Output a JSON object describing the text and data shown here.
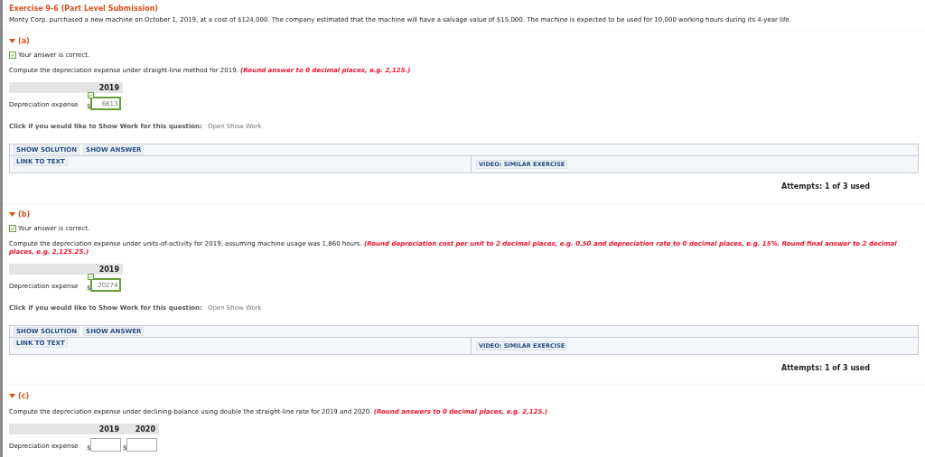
{
  "header": {
    "title": "Exercise 9-6 (Part Level Submission)",
    "description": "Monty Corp. purchased a new machine on October 1, 2019, at a cost of $124,000. The company estimated that the machine will have a salvage value of $15,000. The machine is expected to be used for 10,000 working hours during its 4-year life."
  },
  "parts": [
    {
      "label": "(a)",
      "expanded": true,
      "feedback": "Your answer is correct.",
      "question": "Compute the depreciation expense under straight-line method for 2019. **(Round answer to 0 decimal places, e.g. 2,125.)**",
      "table": {
        "columns": [
          "2019"
        ],
        "row_label": "Depreciation expense",
        "currency": "$",
        "answers": [
          {
            "value": "6813",
            "correct": true
          }
        ]
      },
      "show_work": {
        "label": "Click if you would like to Show Work for this question:",
        "link": "Open Show Work"
      },
      "buttons": [
        "SHOW SOLUTION",
        "SHOW ANSWER"
      ],
      "link_button": "LINK TO TEXT",
      "video_button": "VIDEO: SIMILAR EXERCISE",
      "attempts": "Attempts: 1 of 3 used"
    },
    {
      "label": "(b)",
      "expanded": true,
      "feedback": "Your answer is correct.",
      "question": "Compute the depreciation expense under units-of-activity for 2019, assuming machine usage was 1,860 hours. **(Round depreciation cost per unit to 2 decimal places, e.g. 0.50 and depreciation rate to 0 decimal places, e.g. 15%. Round final answer to 2 decimal places, e.g. 2,125.25.)**",
      "table": {
        "columns": [
          "2019"
        ],
        "row_label": "Depreciation expense",
        "currency": "$",
        "answers": [
          {
            "value": "20274",
            "correct": true
          }
        ]
      },
      "show_work": {
        "label": "Click if you would like to Show Work for this question:",
        "link": "Open Show Work"
      },
      "buttons": [
        "SHOW SOLUTION",
        "SHOW ANSWER"
      ],
      "link_button": "LINK TO TEXT",
      "video_button": "VIDEO: SIMILAR EXERCISE",
      "attempts": "Attempts: 1 of 3 used"
    },
    {
      "label": "(c)",
      "expanded": true,
      "question": "Compute the depreciation expense under declining-balance using double the straight-line rate for 2019 and 2020. **(Round answers to 0 decimal places, e.g. 2,125.)**",
      "table": {
        "columns": [
          "2019",
          "2020"
        ],
        "row_label": "Depreciation expense",
        "currency": "$",
        "answers": [
          {
            "correct": false
          },
          {
            "correct": false
          }
        ]
      }
    }
  ]
}
